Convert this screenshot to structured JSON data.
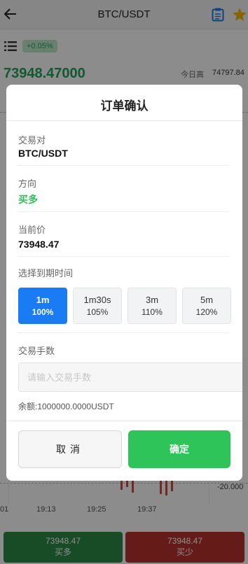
{
  "header": {
    "title": "BTC/USDT",
    "back_icon": "back-arrow-icon",
    "doc_icon": "order-list-icon",
    "star_icon": "star-icon",
    "accent": "#1a7cf5",
    "star_color": "#f2b705"
  },
  "ticker": {
    "change_badge": "+0.05%",
    "last_price": "73948.47000",
    "high_label": "今日高",
    "high_value": "74797.84"
  },
  "chart": {
    "time_ticks": [
      "01",
      "19:13",
      "19:25",
      "19:37"
    ],
    "side_value": "-20.000"
  },
  "bottom_bar": {
    "buy_price": "73948.47",
    "buy_label": "买多",
    "sell_price": "73948.47",
    "sell_label": "买少",
    "buy_color": "#2a8a46",
    "sell_color": "#b8332f"
  },
  "modal": {
    "title": "订单确认",
    "pair_label": "交易对",
    "pair_value": "BTC/USDT",
    "direction_label": "方向",
    "direction_value": "买多",
    "price_label": "当前价",
    "price_value": "73948.47",
    "expiry_label": "选择到期时间",
    "expiry_options": [
      {
        "time": "1m",
        "rate": "100%",
        "selected": true
      },
      {
        "time": "1m30s",
        "rate": "105%",
        "selected": false
      },
      {
        "time": "3m",
        "rate": "110%",
        "selected": false
      },
      {
        "time": "5m",
        "rate": "120%",
        "selected": false
      }
    ],
    "amount_label": "交易手数",
    "amount_placeholder": "请输入交易手数",
    "amount_value": "",
    "balance": "余额:1000000.0000USDT",
    "cancel_label": "取消",
    "confirm_label": "确定",
    "confirm_color": "#2fc45a",
    "direction_color": "#2fbf5a"
  }
}
